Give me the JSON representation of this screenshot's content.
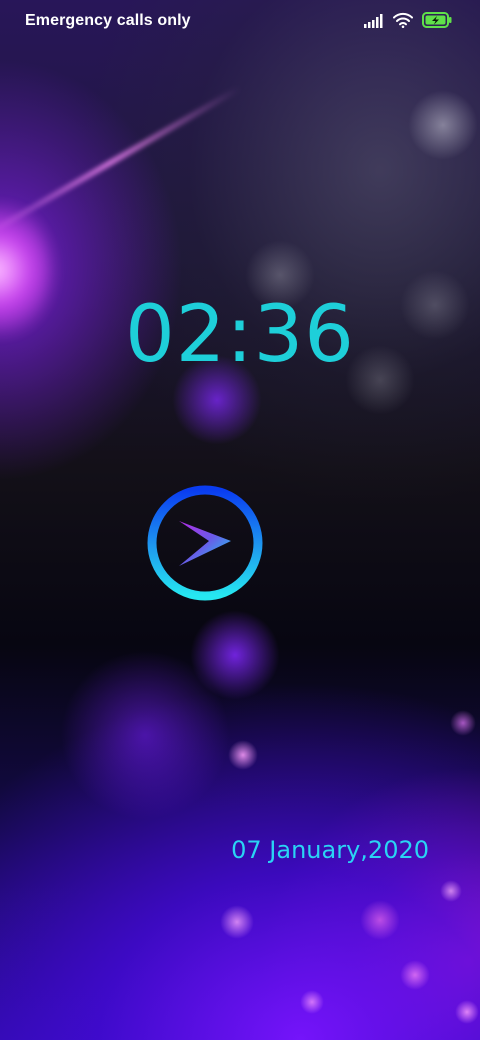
{
  "status_bar": {
    "carrier_text": "Emergency calls only",
    "icons": [
      "signal-icon",
      "wifi-icon",
      "battery-charging-icon"
    ]
  },
  "lockscreen": {
    "time": "02:36",
    "date": "07 January,2020",
    "unlock_icon": "chevron-right-icon"
  },
  "colors": {
    "clock": "#1ecfd9",
    "date": "#2ad4f4",
    "battery": "#5fe04a",
    "ring_gradient": [
      "#0a3cf0",
      "#22e6f0"
    ],
    "chevron_gradient": [
      "#b02ce6",
      "#1ad6f0"
    ]
  }
}
